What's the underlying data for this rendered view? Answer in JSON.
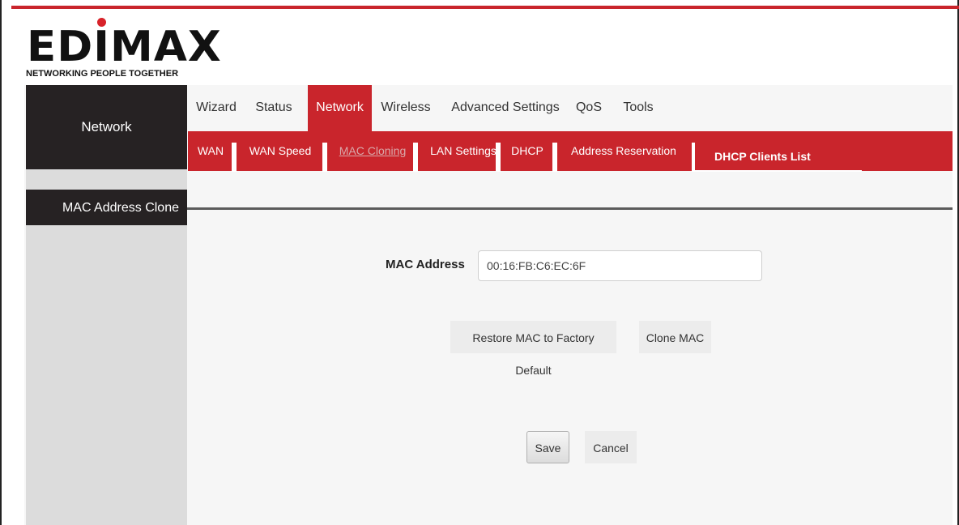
{
  "logo": {
    "brand": "EDIMAX",
    "tagline": "NETWORKING PEOPLE TOGETHER"
  },
  "sidebar": {
    "section_title": "Network",
    "items": [
      {
        "label": "MAC Address Clone",
        "active": true
      }
    ]
  },
  "top_nav": {
    "tabs": [
      {
        "label": "Wizard",
        "active": false
      },
      {
        "label": "Status",
        "active": false
      },
      {
        "label": "Network",
        "active": true
      },
      {
        "label": "Wireless",
        "active": false
      },
      {
        "label": "Advanced Settings",
        "active": false
      },
      {
        "label": "QoS",
        "active": false
      },
      {
        "label": "Tools",
        "active": false
      }
    ]
  },
  "sub_nav": {
    "tabs": [
      {
        "label": "WAN"
      },
      {
        "label": "WAN Speed"
      },
      {
        "label": "MAC Cloning",
        "current": true
      },
      {
        "label": "LAN Settings"
      },
      {
        "label": "DHCP"
      },
      {
        "label": "Address Reservation"
      },
      {
        "label": "DHCP Clients List"
      }
    ]
  },
  "form": {
    "mac_address_label": "MAC Address",
    "mac_address_value": "00:16:FB:C6:EC:6F",
    "restore_label": "Restore MAC to Factory Default",
    "clone_label": "Clone MAC",
    "save_label": "Save",
    "cancel_label": "Cancel"
  },
  "colors": {
    "accent_red": "#c9252c",
    "dark": "#262223",
    "sidebar_bg": "#dcdcdc",
    "page_bg": "#f6f6f6"
  }
}
